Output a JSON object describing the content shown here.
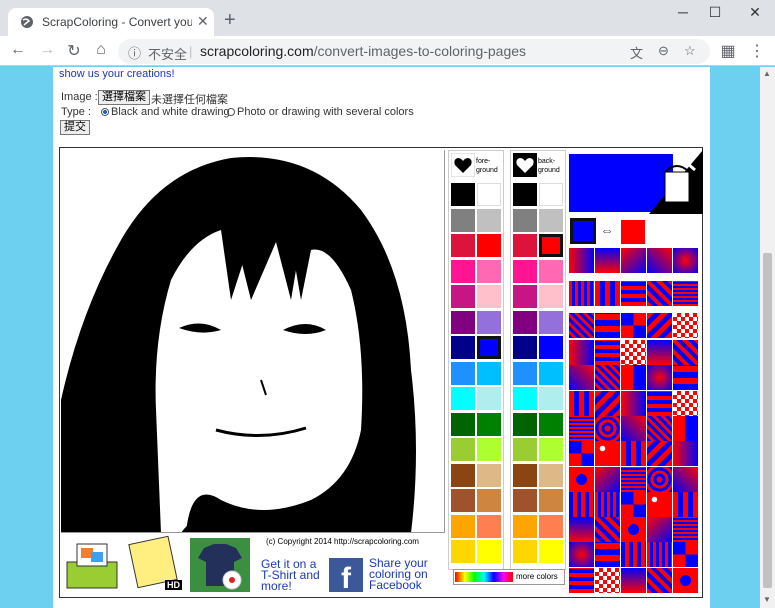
{
  "browser": {
    "tab_title": "ScrapColoring - Convert your D",
    "close_glyph": "✕",
    "newtab_glyph": "+",
    "url_host": "scrapcoloring.com",
    "url_path": "/convert-images-to-coloring-pages",
    "security_label": "不安全",
    "minimize": "─",
    "maximize": "☐",
    "close": "✕"
  },
  "page": {
    "share_text": "show us your creations!",
    "image_label": "Image :",
    "file_button": "選擇檔案",
    "file_status": "未選擇任何檔案",
    "type_label": "Type :",
    "option_bw": "Black and white drawing",
    "option_color": "Photo or drawing with several colors",
    "submit": "提交"
  },
  "palette": {
    "foreground_label": "fore-\nground",
    "background_label": "back-\nground",
    "colors": [
      [
        "#000000",
        "#ffffff"
      ],
      [
        "#808080",
        "#c0c0c0"
      ],
      [
        "#dc143c",
        "#ff0000"
      ],
      [
        "#ff1493",
        "#ff69b4"
      ],
      [
        "#c71585",
        "#ffc0cb"
      ],
      [
        "#800080",
        "#9370db"
      ],
      [
        "#00008b",
        "#0000ff"
      ],
      [
        "#1e90ff",
        "#00bfff"
      ],
      [
        "#00ffff",
        "#afeeee"
      ],
      [
        "#006400",
        "#008000"
      ],
      [
        "#9acd32",
        "#adff2f"
      ],
      [
        "#8b4513",
        "#deb887"
      ],
      [
        "#a0522d",
        "#cd853f"
      ],
      [
        "#ffa500",
        "#ff7f50"
      ],
      [
        "#ffd700",
        "#ffff00"
      ]
    ],
    "foreground_color": "#0000ff",
    "background_color": "#ff0000",
    "more_colors": "more colors",
    "swap_icon": "⇔"
  },
  "bottom": {
    "copyright": "(c) Copyright 2014 http://scrapcoloring.com",
    "tshirt_text": "Get it on a T-Shirt and more!",
    "facebook_text": "Share your coloring on Facebook",
    "hd_badge": "HD"
  }
}
